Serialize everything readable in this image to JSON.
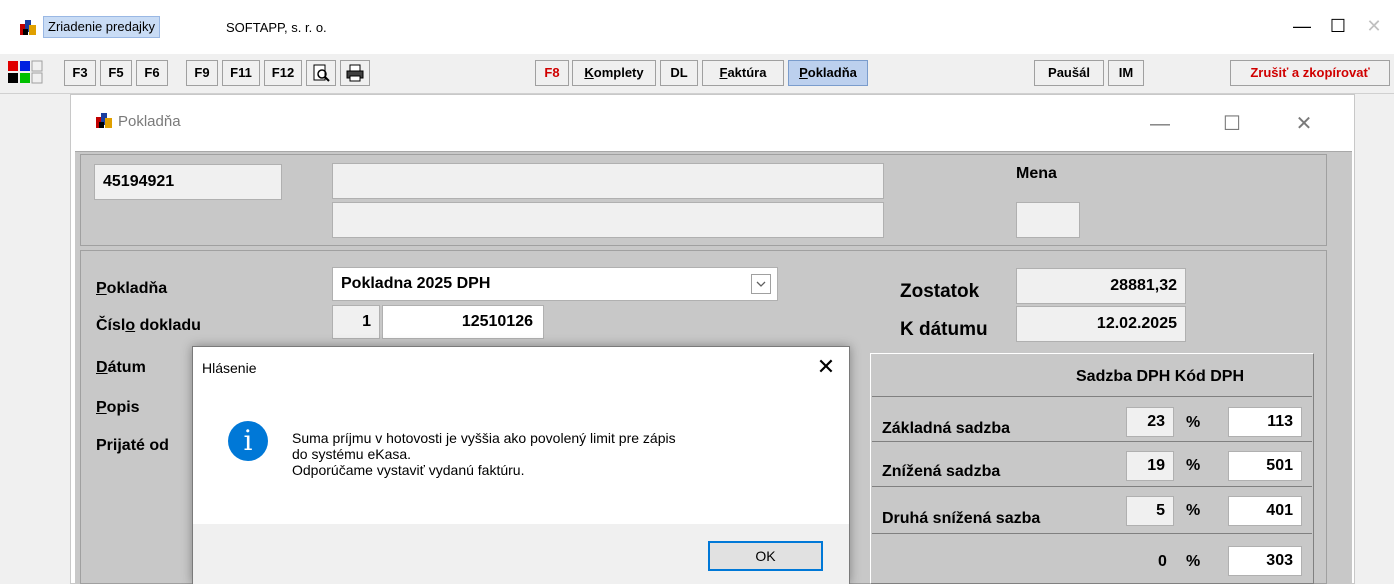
{
  "app": {
    "title": "Zriadenie predajky",
    "company": "SOFTAPP, s. r. o."
  },
  "window_controls": {
    "minimize": "—",
    "maximize": "☐",
    "close": "✕"
  },
  "toolbar": {
    "f3": "F3",
    "f5": "F5",
    "f6": "F6",
    "f9": "F9",
    "f11": "F11",
    "f12": "F12",
    "f8": "F8",
    "komplety_ul": "K",
    "komplety_rest": "omplety",
    "dl": "DL",
    "faktura_ul": "F",
    "faktura_rest": "aktúra",
    "pokladna_ul": "P",
    "pokladna_rest": "okladňa",
    "pausal": "Paušál",
    "im": "IM",
    "zrusit": "Zrušiť a zkopírovať"
  },
  "pokladna_window": {
    "title": "Pokladňa"
  },
  "header": {
    "ico": "45194921",
    "name1": "",
    "name2": "",
    "mena_label": "Mena",
    "mena_value": ""
  },
  "form": {
    "pokladna_ul": "P",
    "pokladna_rest": "okladňa",
    "pokladna_value": "Pokladna 2025 DPH",
    "cislo_pre": "Čísl",
    "cislo_ul": "o",
    "cislo_rest": " dokladu",
    "cislo_series": "1",
    "cislo_value": "12510126",
    "datum_ul": "D",
    "datum_rest": "átum",
    "popis_ul": "P",
    "popis_rest": "opis",
    "prijate_od": "Prijaté od"
  },
  "balance": {
    "zostatok_label": "Zostatok",
    "zostatok_value": "28881,32",
    "kdatumu_label": "K dátumu",
    "kdatumu_value": "12.02.2025"
  },
  "vat": {
    "header": "Sadzba DPH Kód DPH",
    "rows": [
      {
        "label": "Základná sadzba",
        "rate": "23",
        "pct": "%",
        "code": "113"
      },
      {
        "label": "Znížená sadzba",
        "rate": "19",
        "pct": "%",
        "code": "501"
      },
      {
        "label": "Druhá snížená sazba",
        "rate": "5",
        "pct": "%",
        "code": "401"
      },
      {
        "label": "",
        "rate": "0",
        "pct": "%",
        "code": "303"
      }
    ]
  },
  "dialog": {
    "title": "Hlásenie",
    "close": "✕",
    "icon_glyph": "i",
    "line1": "Suma príjmu v hotovosti je vyššia ako povolený limit pre zápis",
    "line2": "do systému eKasa.",
    "line3": "Odporúčame vystaviť vydanú faktúru.",
    "ok": "OK"
  },
  "colors": {
    "accent": "#0078d7",
    "selected_tab": "#bcd0ee",
    "alert_red": "#d00000",
    "form_bg": "#c8c8c8"
  }
}
